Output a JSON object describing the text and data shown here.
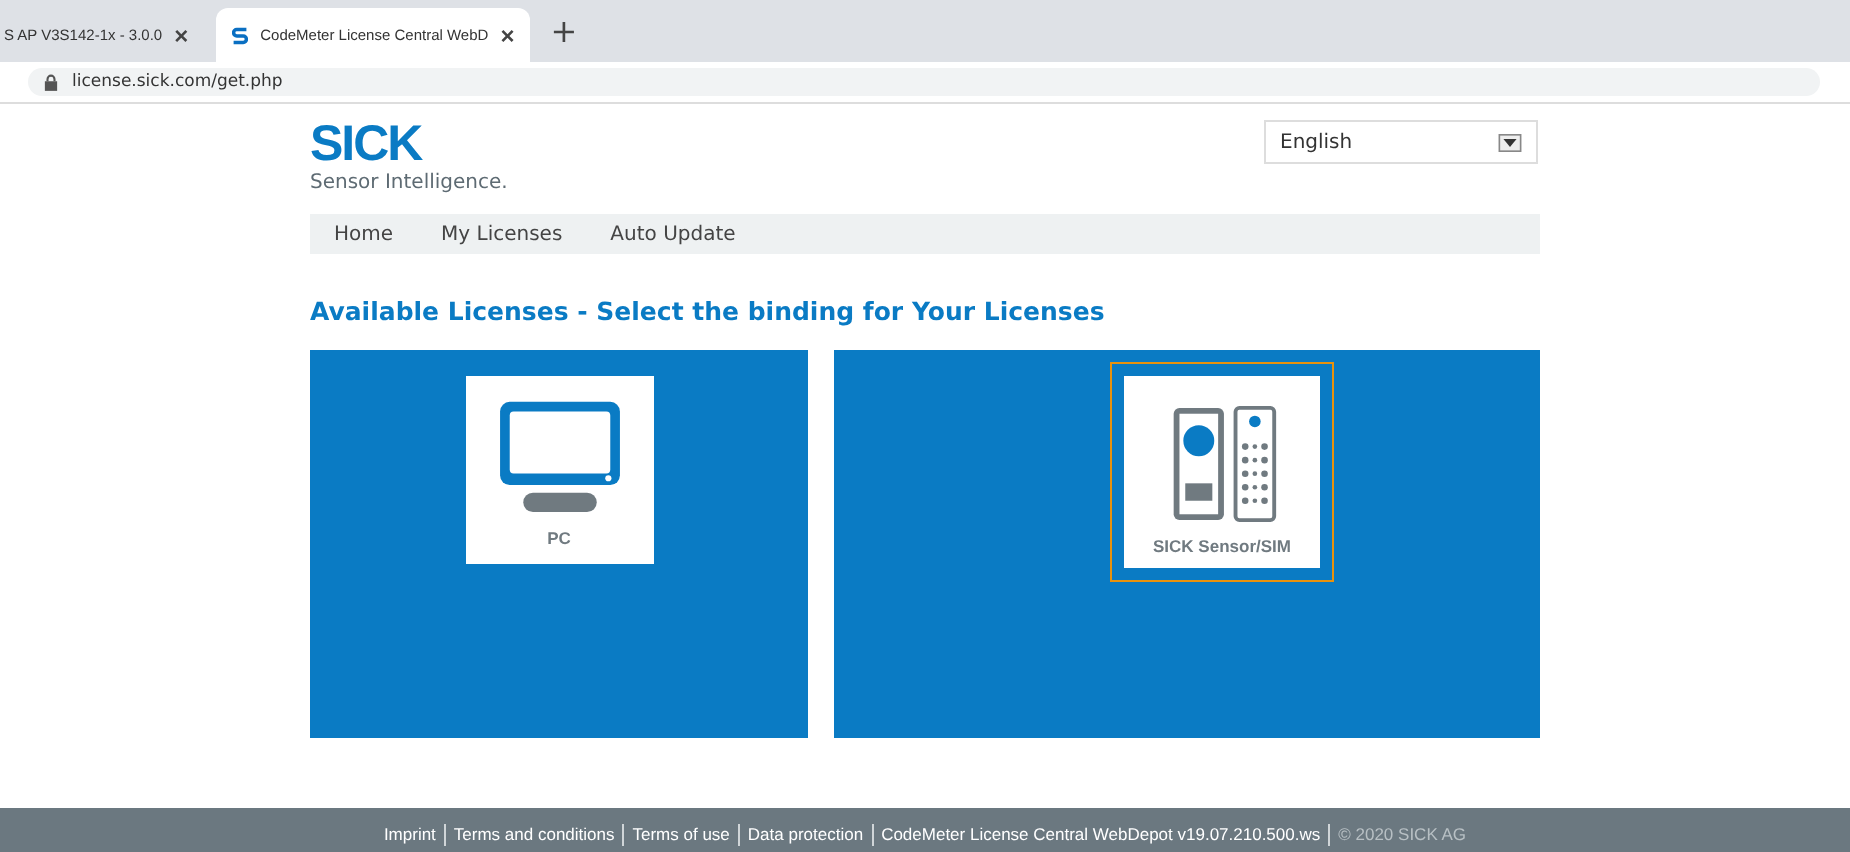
{
  "browser": {
    "tabs": [
      {
        "title": "S AP V3S142-1x - 3.0.0",
        "selected": false
      },
      {
        "title": "CodeMeter License Central WebD",
        "selected": true
      }
    ],
    "new_tab": "+",
    "close": "×",
    "address": "license.sick.com/get.php"
  },
  "header": {
    "logo": "SICK",
    "tagline": "Sensor Intelligence.",
    "language": "English"
  },
  "nav": [
    "Home",
    "My Licenses",
    "Auto Update"
  ],
  "heading": "Available Licenses - Select the binding for Your Licenses",
  "tiles": [
    {
      "kind": "pc",
      "label": "PC",
      "selected": false
    },
    {
      "kind": "sensor",
      "label": "SICK Sensor/SIM",
      "selected": true
    }
  ],
  "footer": {
    "links": [
      "Imprint",
      "Terms and conditions",
      "Terms of use",
      "Data protection",
      "CodeMeter License Central WebDepot v19.07.210.500.ws"
    ],
    "copyright": "© 2020 SICK AG"
  }
}
